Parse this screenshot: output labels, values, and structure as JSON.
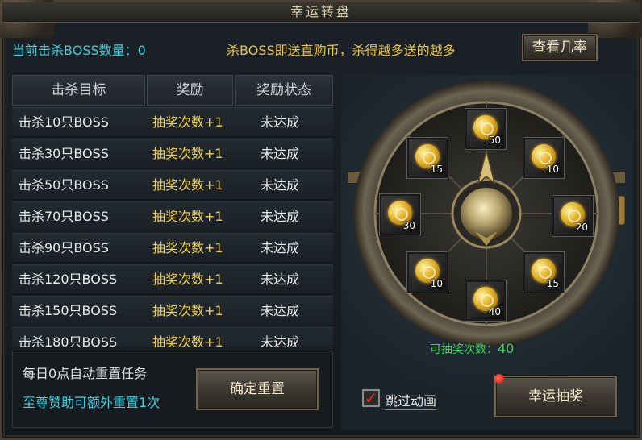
{
  "window": {
    "title": "幸运转盘"
  },
  "header": {
    "kill_count_text": "当前击杀BOSS数量：0",
    "promo_text": "杀BOSS即送直购币，杀得越多送的越多",
    "odds_button": "查看几率"
  },
  "table": {
    "headers": [
      "击杀目标",
      "奖励",
      "奖励状态"
    ],
    "rows": [
      {
        "target": "击杀10只BOSS",
        "reward": "抽奖次数+1",
        "status": "未达成"
      },
      {
        "target": "击杀30只BOSS",
        "reward": "抽奖次数+1",
        "status": "未达成"
      },
      {
        "target": "击杀50只BOSS",
        "reward": "抽奖次数+1",
        "status": "未达成"
      },
      {
        "target": "击杀70只BOSS",
        "reward": "抽奖次数+1",
        "status": "未达成"
      },
      {
        "target": "击杀90只BOSS",
        "reward": "抽奖次数+1",
        "status": "未达成"
      },
      {
        "target": "击杀120只BOSS",
        "reward": "抽奖次数+1",
        "status": "未达成"
      },
      {
        "target": "击杀150只BOSS",
        "reward": "抽奖次数+1",
        "status": "未达成"
      },
      {
        "target": "击杀180只BOSS",
        "reward": "抽奖次数+1",
        "status": "未达成"
      }
    ]
  },
  "reset": {
    "daily_text": "每日0点自动重置任务",
    "vip_text": "至尊赞助可额外重置1次",
    "confirm_button": "确定重置"
  },
  "wheel": {
    "slots": [
      {
        "value": "50",
        "icon": "gold-coin-icon"
      },
      {
        "value": "10",
        "icon": "gold-coin-icon"
      },
      {
        "value": "20",
        "icon": "gold-coin-icon"
      },
      {
        "value": "15",
        "icon": "gold-coin-icon"
      },
      {
        "value": "40",
        "icon": "gold-coin-icon"
      },
      {
        "value": "10",
        "icon": "gold-coin-icon"
      },
      {
        "value": "30",
        "icon": "gold-coin-icon"
      },
      {
        "value": "15",
        "icon": "gold-coin-icon"
      }
    ],
    "draw_count_label": "可抽奖次数：",
    "draw_count_value": "40"
  },
  "footer": {
    "skip_animation_label": "跳过动画",
    "skip_animation_checked": true,
    "lucky_draw_button": "幸运抽奖"
  },
  "colors": {
    "cyan_text": "#3ad2e0",
    "gold_text": "#e6c44a",
    "green_text": "#3bd25a",
    "check_red": "#e02b2b"
  }
}
